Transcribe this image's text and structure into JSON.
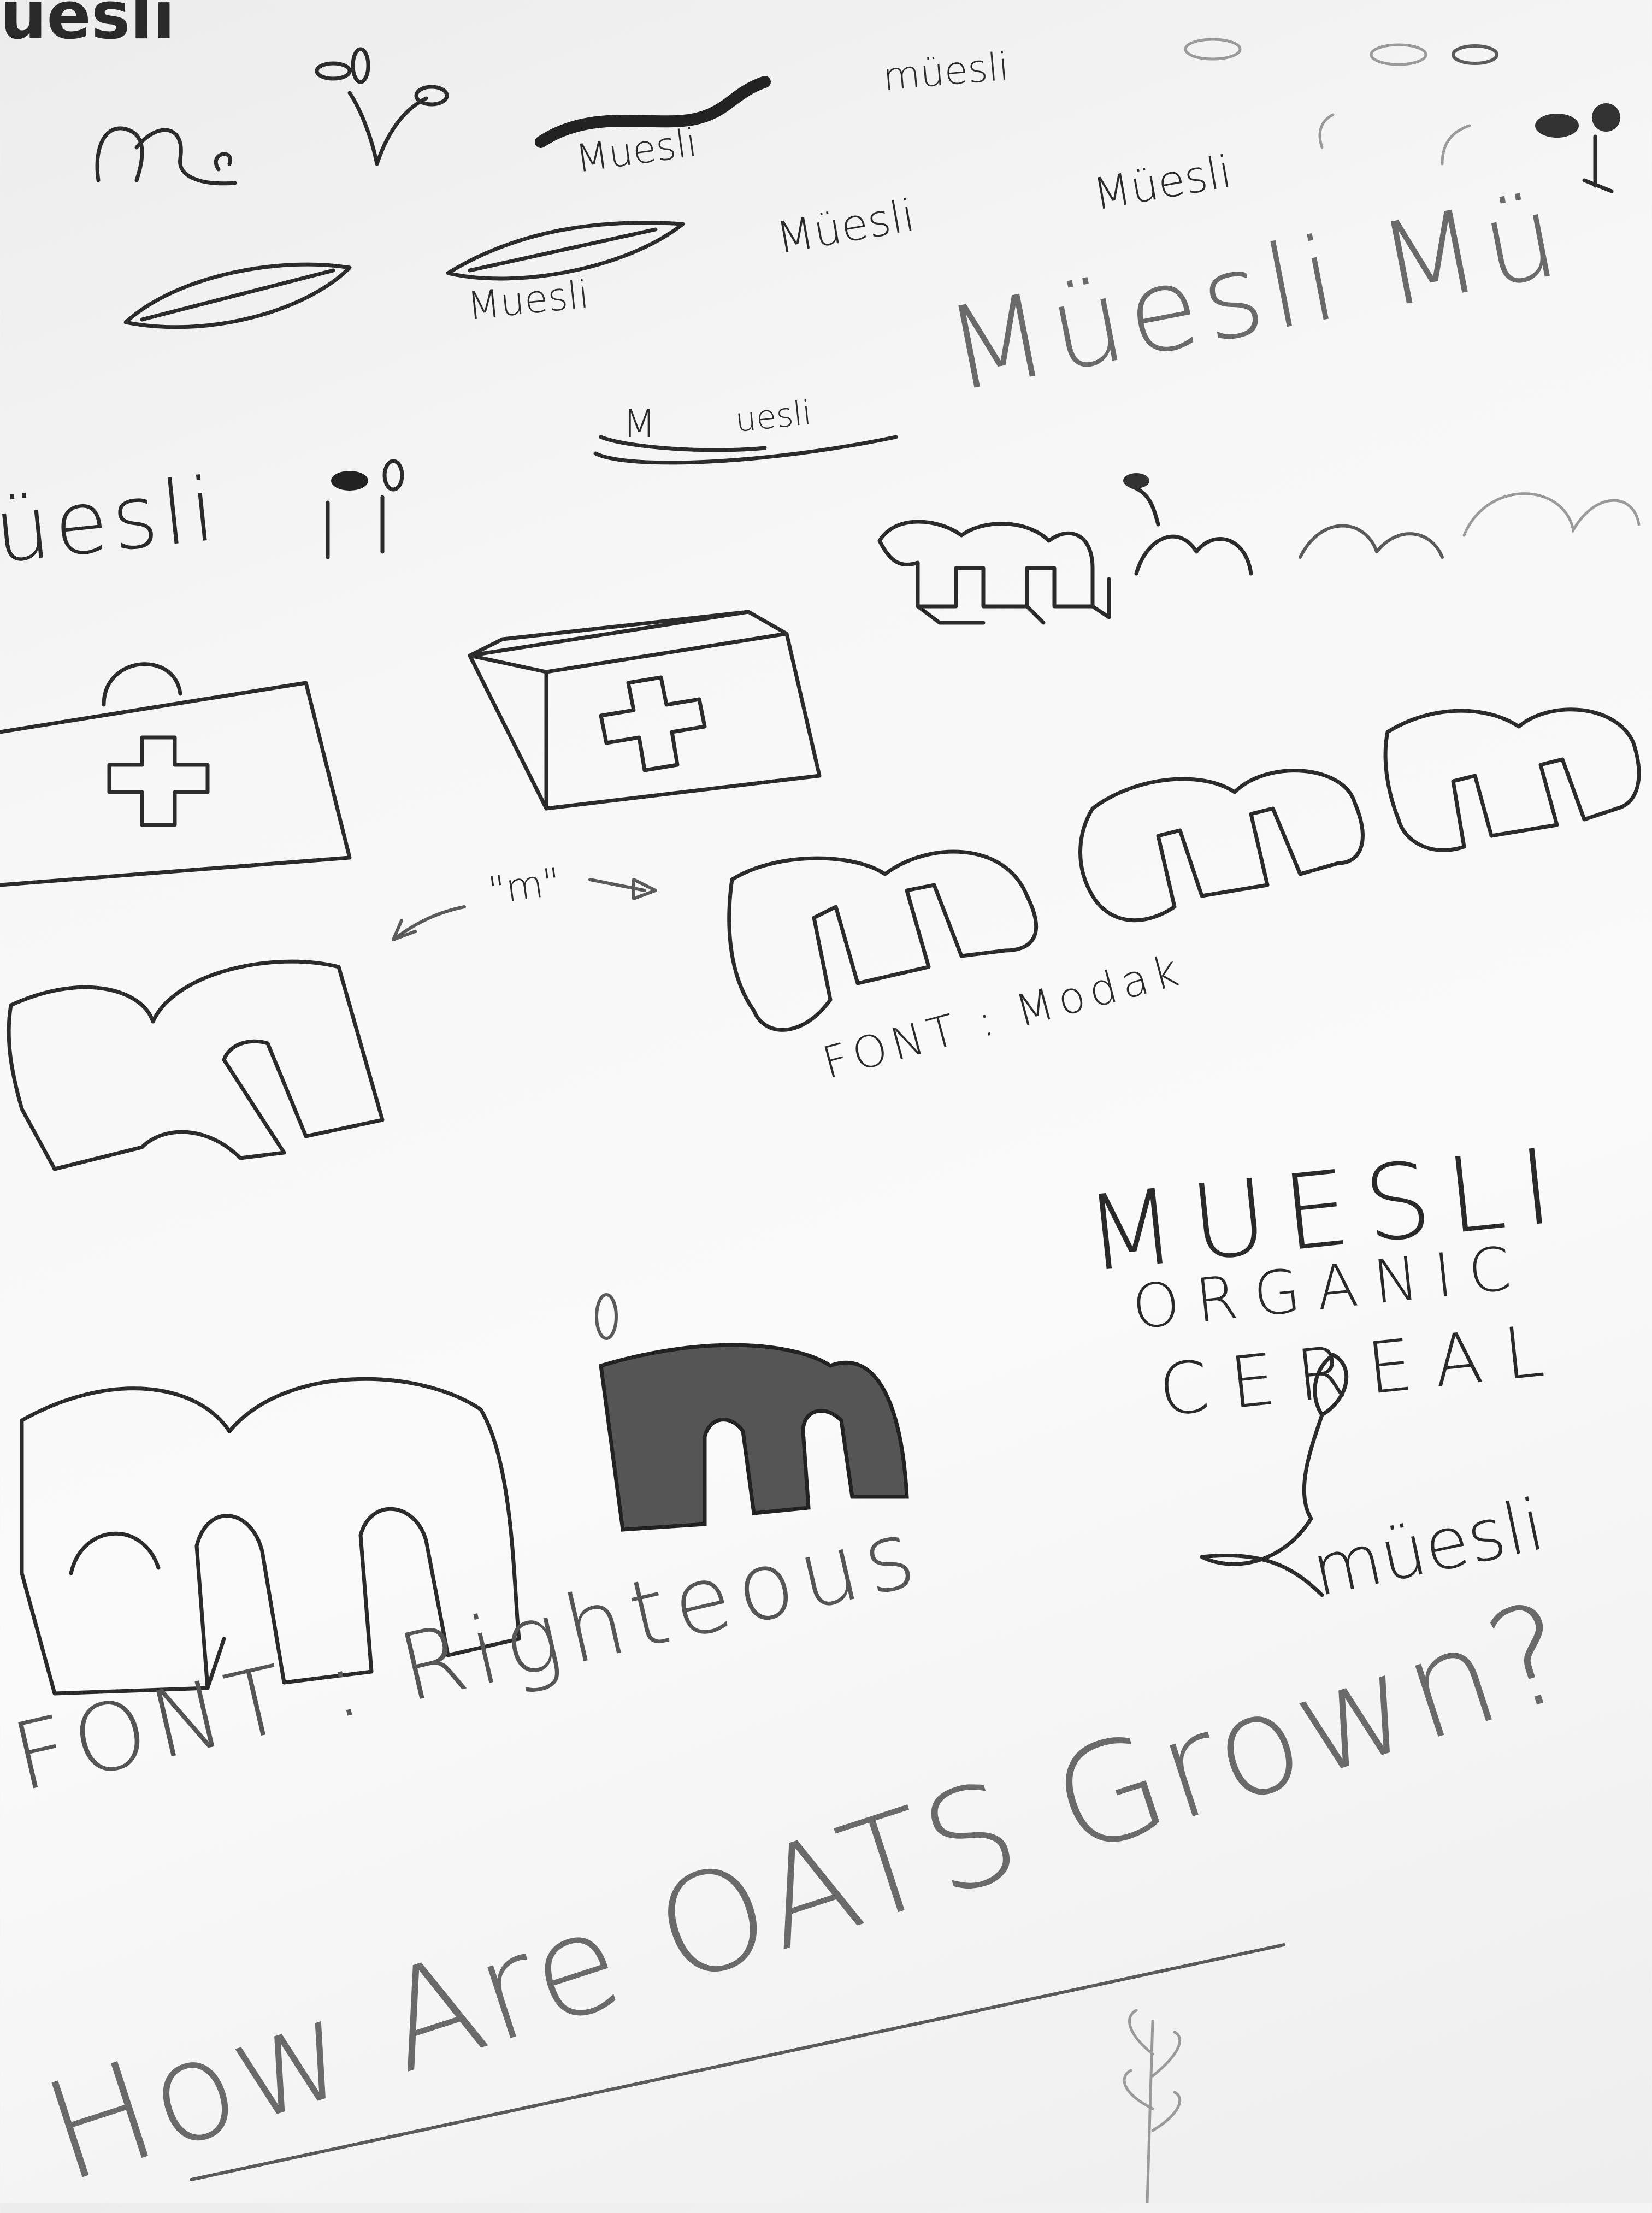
{
  "sketch_sheet": {
    "logo_wordmarks": [
      "uesli",
      "müesli",
      "Muesli",
      "Müesli",
      "Müesli",
      "Muesli",
      "Müesli Mü",
      "M",
      "uesli",
      "üesli",
      "müesli"
    ],
    "annotations": {
      "m_label": "\"m\"",
      "font_modak": "FONT : Modak",
      "font_righteous": "FONT : Righteous"
    },
    "tagline": {
      "line1": "MUESLI",
      "line2": "ORGANIC",
      "line3": "CEREAL"
    },
    "heading": "How Are OATS Grown?",
    "ink_color": "#2b2b2b",
    "paper_color": "#f7f7f7"
  }
}
